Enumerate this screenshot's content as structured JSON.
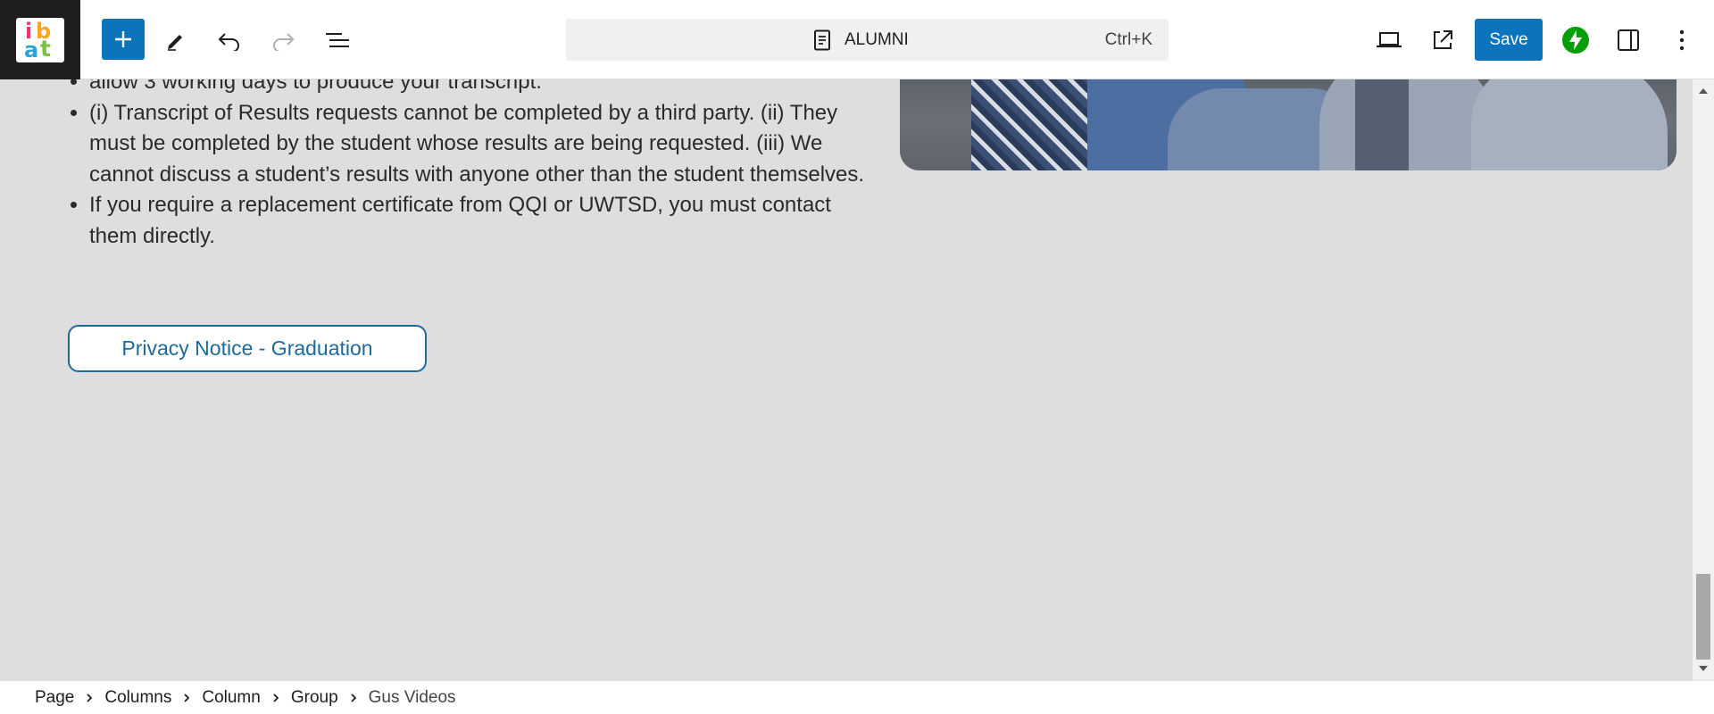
{
  "toolbar": {
    "logo_text": {
      "i": "i",
      "b": "b",
      "a": "a",
      "t": "t"
    },
    "icons": [
      "add-block-icon",
      "pencil-icon",
      "undo-icon",
      "redo-icon",
      "list-view-icon",
      "desktop-preview-icon",
      "external-link-icon",
      "jetpack-icon",
      "sidebar-settings-icon",
      "more-options-icon"
    ],
    "command_bar": {
      "title": "ALUMNI",
      "shortcut": "Ctrl+K"
    },
    "save_label": "Save"
  },
  "content": {
    "list_items": [
      "allow 3 working days to produce your transcript.",
      "(i) Transcript of Results requests cannot be completed by a third party. (ii) They must be completed by the student whose results are being requested. (iii) We cannot discuss a student’s results with anyone other than the student themselves.",
      "If you require a replacement certificate from QQI or UWTSD, you must contact them directly."
    ],
    "privacy_button": "Privacy Notice - Graduation"
  },
  "breadcrumb": [
    "Page",
    "Columns",
    "Column",
    "Group",
    "Gus Videos"
  ],
  "colors": {
    "accent": "#0c74bd",
    "jetpack": "#069e08",
    "canvas": "#dedede"
  }
}
